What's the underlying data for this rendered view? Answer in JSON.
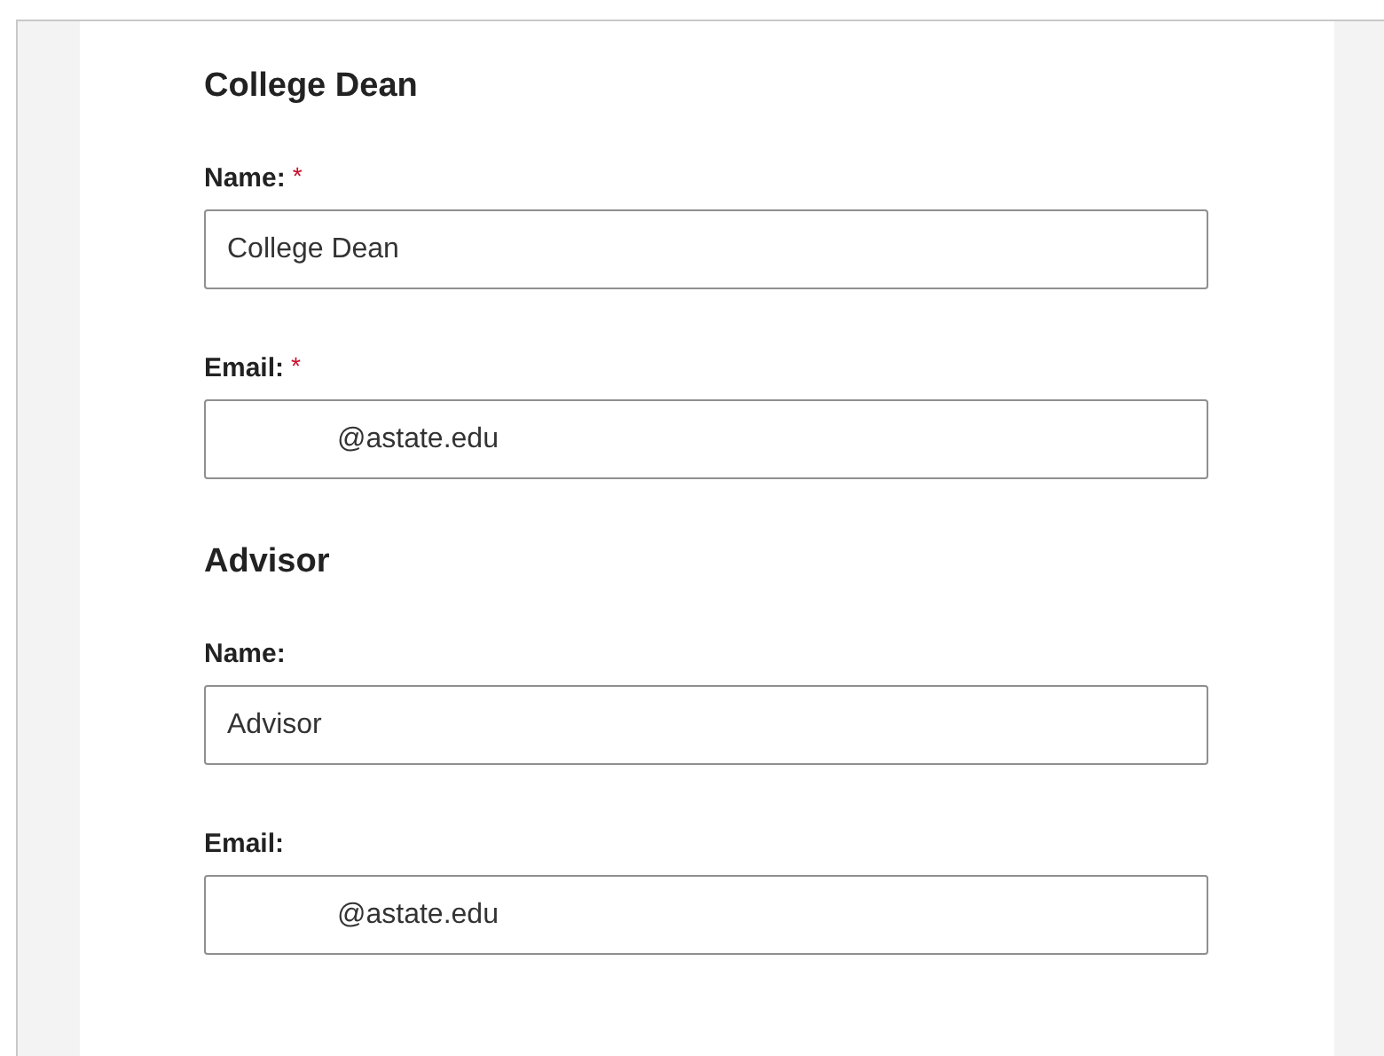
{
  "sections": [
    {
      "title": "College Dean",
      "fields": [
        {
          "label": "Name:",
          "required_mark": "*",
          "kind": "text",
          "value": "College Dean"
        },
        {
          "label": "Email:",
          "required_mark": "*",
          "kind": "email",
          "value": "@astate.edu"
        }
      ]
    },
    {
      "title": "Advisor",
      "fields": [
        {
          "label": "Name:",
          "kind": "text",
          "value": "Advisor"
        },
        {
          "label": "Email:",
          "kind": "email",
          "value": "@astate.edu"
        }
      ]
    }
  ]
}
